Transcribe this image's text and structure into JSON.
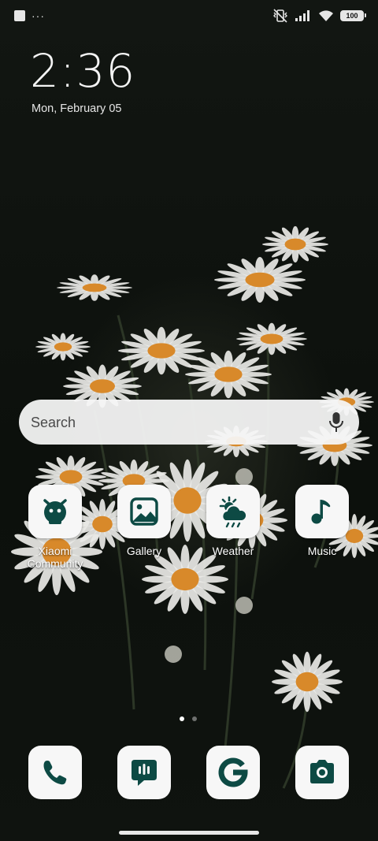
{
  "status_bar": {
    "left_icons": [
      "notification-square-icon",
      "more-notifications-icon"
    ],
    "overflow_text": "···",
    "right_icons": [
      "vibrate-off-icon",
      "signal-icon",
      "wifi-icon",
      "battery-icon"
    ],
    "battery": "100"
  },
  "clock": {
    "time": "2:36",
    "date": "Mon, February 05"
  },
  "search": {
    "placeholder": "Search",
    "icon": "mic-icon"
  },
  "apps": [
    {
      "label": "Xiaomi Community",
      "icon": "xiaomi-community-icon"
    },
    {
      "label": "Gallery",
      "icon": "gallery-icon"
    },
    {
      "label": "Weather",
      "icon": "weather-icon"
    },
    {
      "label": "Music",
      "icon": "music-icon"
    }
  ],
  "page_indicator": {
    "pages": 2,
    "current": 1
  },
  "dock": [
    {
      "icon": "phone-icon"
    },
    {
      "icon": "messages-icon"
    },
    {
      "icon": "google-icon"
    },
    {
      "icon": "camera-icon"
    }
  ],
  "colors": {
    "icon_accent": "#0d4a44",
    "tile": "#f7f7f7",
    "petal": "#e9e9e6",
    "flower_center": "#d8892a"
  }
}
